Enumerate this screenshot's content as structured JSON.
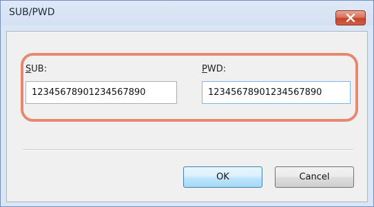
{
  "window": {
    "title": "SUB/PWD",
    "close_icon": "close-icon"
  },
  "form": {
    "sub_label_key": "S",
    "sub_label_rest": "UB:",
    "sub_value": "12345678901234567890",
    "pwd_label_key": "P",
    "pwd_label_rest": "WD:",
    "pwd_value": "12345678901234567890"
  },
  "buttons": {
    "ok_label": "OK",
    "cancel_label": "Cancel"
  },
  "colors": {
    "highlight": "#e5886d",
    "close_button": "#c6432b",
    "window_frame": "#dbe6f4"
  }
}
